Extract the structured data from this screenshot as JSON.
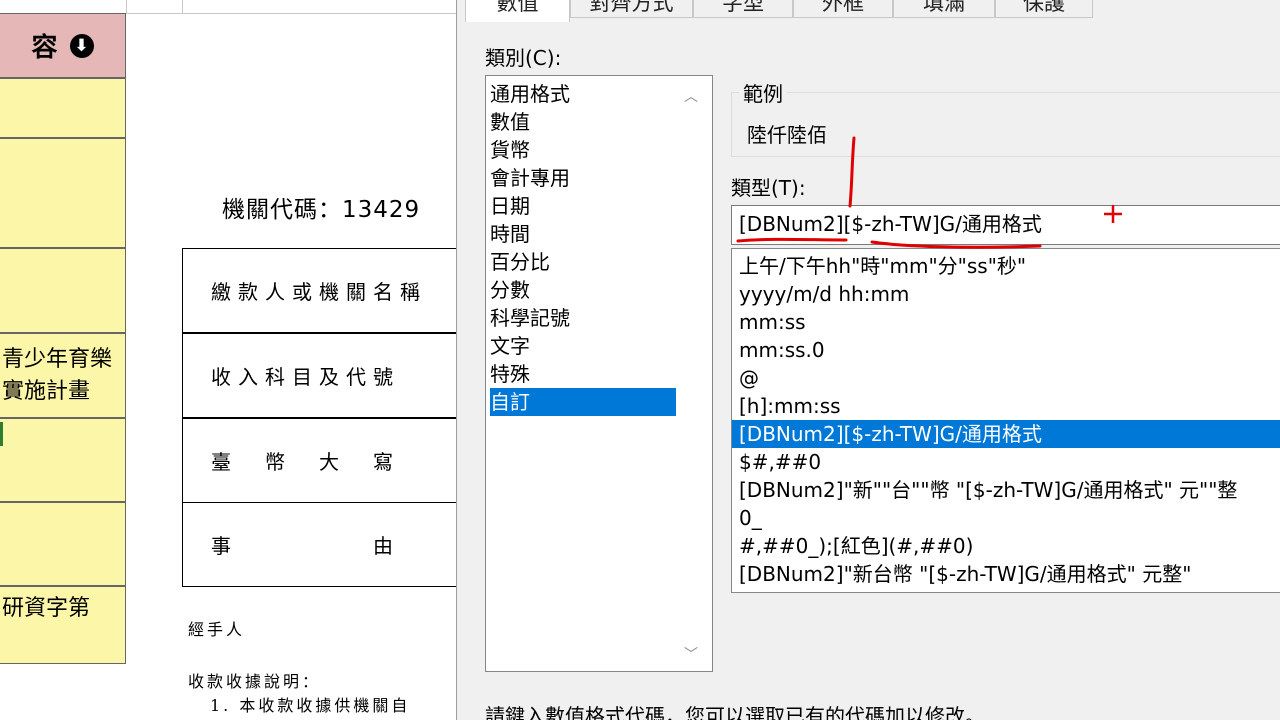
{
  "sheet": {
    "header_cell": "容",
    "cells": [
      "",
      "",
      "",
      "",
      "青少年育樂\n實施計畫",
      "",
      "",
      "研資字第"
    ],
    "agency_code": "機關代碼：13429",
    "form_rows": [
      "繳款人或機關名稱",
      "收入科目及代號",
      "臺　幣　大　寫",
      "事　　　　　由"
    ],
    "handler": "經手人",
    "receipt_note": "收款收據說明：",
    "receipt_item": "1. 本收款收據供機關自"
  },
  "dialog": {
    "tabs": [
      "數值",
      "對齊方式",
      "字型",
      "外框",
      "填滿",
      "保護"
    ],
    "active_tab": 0,
    "category_label": "類別(C):",
    "categories": [
      "通用格式",
      "數值",
      "貨幣",
      "會計專用",
      "日期",
      "時間",
      "百分比",
      "分數",
      "科學記號",
      "文字",
      "特殊",
      "自訂"
    ],
    "selected_category": 11,
    "sample_label": "範例",
    "sample_value": "陸仟陸佰",
    "type_label": "類型(T):",
    "type_value": "[DBNum2][$-zh-TW]G/通用格式",
    "format_codes": [
      "上午/下午hh\"時\"mm\"分\"ss\"秒\"",
      "yyyy/m/d hh:mm",
      "mm:ss",
      "mm:ss.0",
      "@",
      "[h]:mm:ss",
      "[DBNum2][$-zh-TW]G/通用格式",
      "$#,##0",
      "[DBNum2]\"新\"\"台\"\"幣 \"[$-zh-TW]G/通用格式\" 元\"\"整",
      "0_",
      "#,##0_);[紅色](#,##0)",
      "[DBNum2]\"新台幣 \"[$-zh-TW]G/通用格式\" 元整\""
    ],
    "selected_format": 6,
    "hint": "請鍵入數值格式代碼，您可以選取已有的代碼加以修改。"
  },
  "colors": {
    "selection": "#0078d7",
    "annotation": "#e00000",
    "cell_yellow": "#fbf6a8",
    "header_pink": "#e5b8b7"
  }
}
